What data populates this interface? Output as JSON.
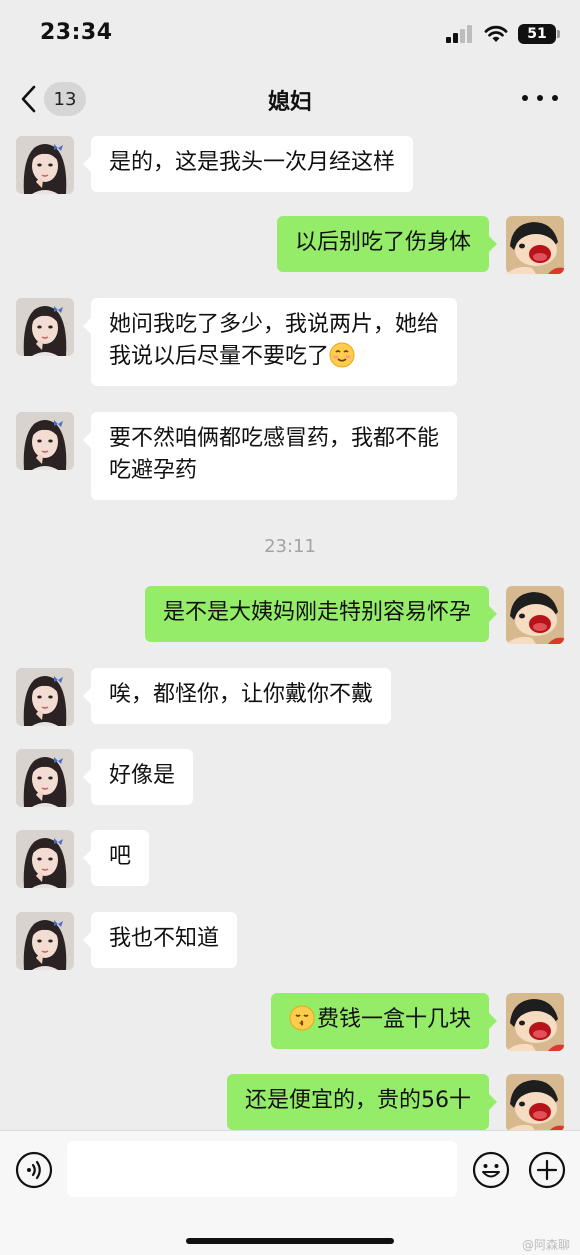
{
  "status_bar": {
    "time": "23:34",
    "battery": "51"
  },
  "nav": {
    "back_count": "13",
    "title": "媳妇"
  },
  "messages": [
    {
      "side": "left",
      "lines": [
        "是的，这是我头一次月经这样"
      ]
    },
    {
      "side": "right",
      "lines": [
        "以后别吃了伤身体"
      ]
    },
    {
      "side": "left",
      "lines": [
        "她问我吃了多少，我说两片，她给",
        "我说以后尽量不要吃了"
      ],
      "emoji_after": "smiling-face-emoji"
    },
    {
      "side": "left",
      "lines": [
        "要不然咱俩都吃感冒药，我都不能",
        "吃避孕药"
      ]
    },
    {
      "side": "right",
      "lines": [
        "是不是大姨妈刚走特别容易怀孕"
      ]
    },
    {
      "side": "left",
      "lines": [
        "唉，都怪你，让你戴你不戴"
      ]
    },
    {
      "side": "left",
      "lines": [
        "好像是"
      ]
    },
    {
      "side": "left",
      "lines": [
        "吧"
      ]
    },
    {
      "side": "left",
      "lines": [
        "我也不知道"
      ]
    },
    {
      "side": "right",
      "lines": [
        "费钱一盒十几块"
      ],
      "emoji_before": "kissing-face-emoji"
    },
    {
      "side": "right",
      "lines": [
        "还是便宜的，贵的56十"
      ]
    }
  ],
  "timestamp": "23:11",
  "colors": {
    "background": "#ededed",
    "own_bubble": "#95ec69",
    "other_bubble": "#ffffff",
    "timestamp_text": "#a3a3a3"
  },
  "input": {
    "value": "",
    "placeholder": ""
  },
  "watermark": "@阿森聊"
}
